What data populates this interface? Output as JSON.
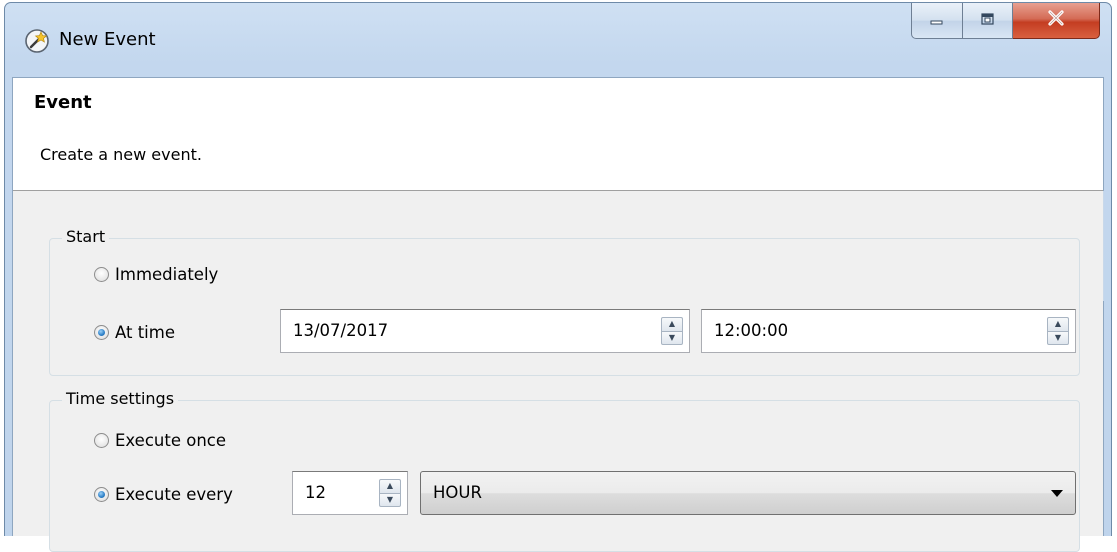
{
  "window": {
    "title": "New Event",
    "icon": "magic-wand-icon"
  },
  "caption_buttons": {
    "minimize_icon": "minimize-icon",
    "maximize_icon": "maximize-icon",
    "close_icon": "close-icon"
  },
  "header": {
    "title": "Event",
    "description": "Create a new event."
  },
  "start": {
    "legend": "Start",
    "immediately_label": "Immediately",
    "immediately_selected": false,
    "at_time_label": "At time",
    "at_time_selected": true,
    "date_value": "13/07/2017",
    "time_value": "12:00:00"
  },
  "time_settings": {
    "legend": "Time settings",
    "execute_once_label": "Execute once",
    "execute_once_selected": false,
    "execute_every_label": "Execute every",
    "execute_every_selected": true,
    "interval_value": "12",
    "unit_value": "HOUR"
  },
  "colors": {
    "title_bar": "#c3d7ee",
    "close_button": "#c43d22",
    "client_background": "#f0f0f0",
    "radio_dot": "#2c7fc7"
  }
}
